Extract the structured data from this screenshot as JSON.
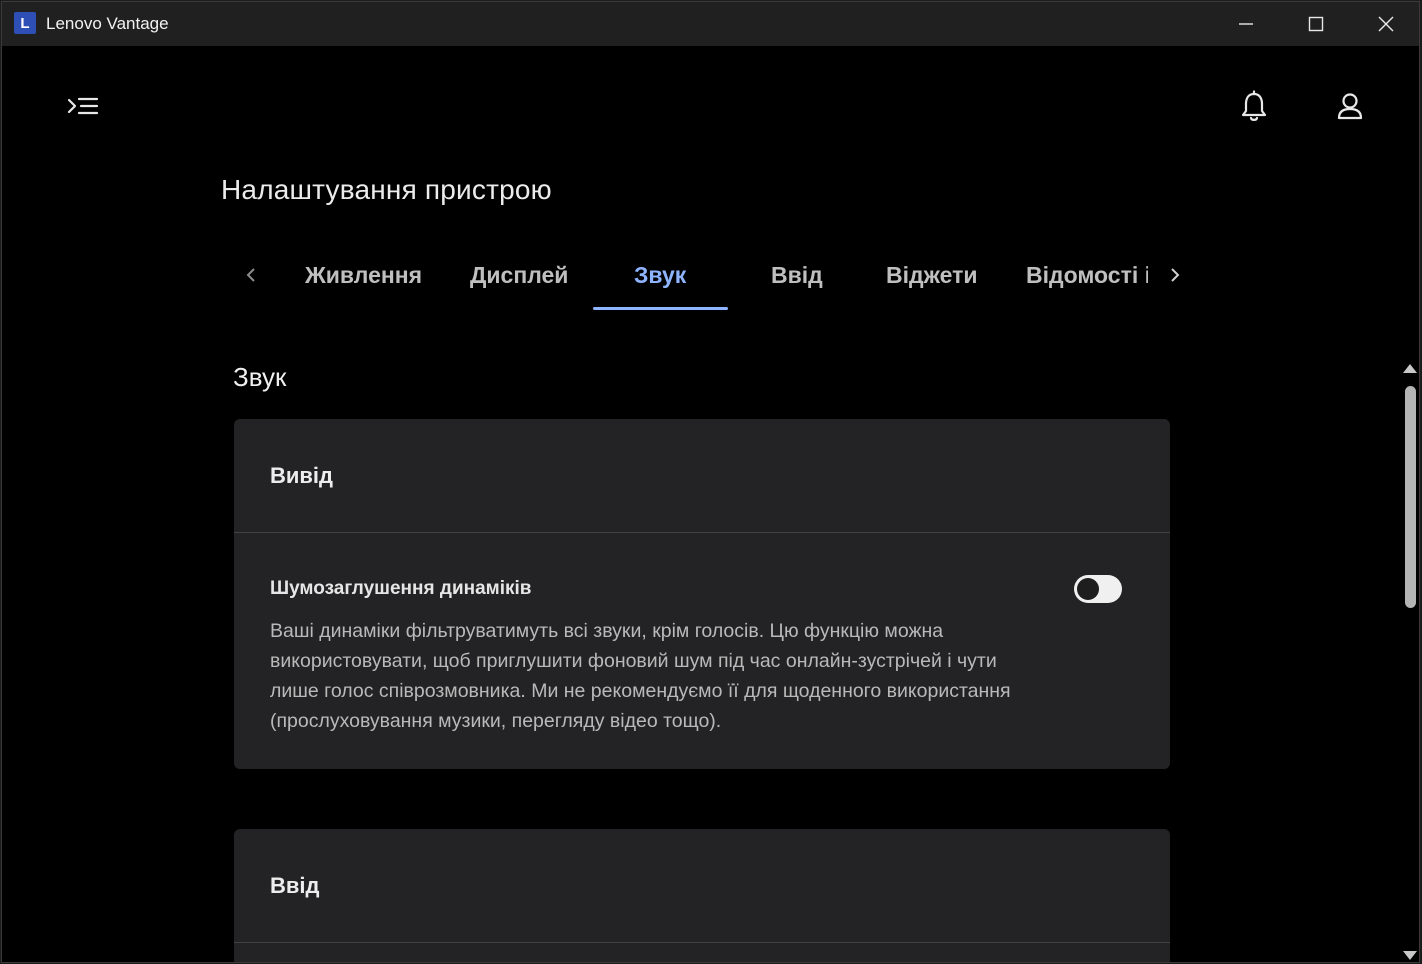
{
  "window": {
    "title": "Lenovo Vantage",
    "logo_letter": "L"
  },
  "page": {
    "title": "Налаштування пристрою"
  },
  "tabs": [
    {
      "label": "Живлення",
      "active": false
    },
    {
      "label": "Дисплей",
      "active": false
    },
    {
      "label": "Звук",
      "active": true
    },
    {
      "label": "Ввід",
      "active": false
    },
    {
      "label": "Віджети",
      "active": false
    },
    {
      "label": "Відомості і",
      "active": false
    }
  ],
  "section": {
    "title": "Звук"
  },
  "output_card": {
    "heading": "Вивід",
    "setting": {
      "label": "Шумозаглушення динаміків",
      "description": "Ваші динаміки фільтруватимуть всі звуки, крім голосів. Цю функцію можна використовувати, щоб приглушити фоновий шум під час онлайн-зустрічей і чути лише голос співрозмовника. Ми не рекомендуємо її для щоденного використання (прослуховування музики, перегляду відео тощо).",
      "enabled": false
    }
  },
  "input_card": {
    "heading": "Ввід"
  },
  "icons": {
    "menu": "menu-expand-icon",
    "notifications": "bell-icon",
    "account": "user-icon",
    "tabs_prev": "chevron-left-icon",
    "tabs_next": "chevron-right-icon"
  },
  "colors": {
    "accent": "#8fb4ff",
    "background": "#000000",
    "card": "#232325",
    "logo": "#2e4fb5"
  }
}
